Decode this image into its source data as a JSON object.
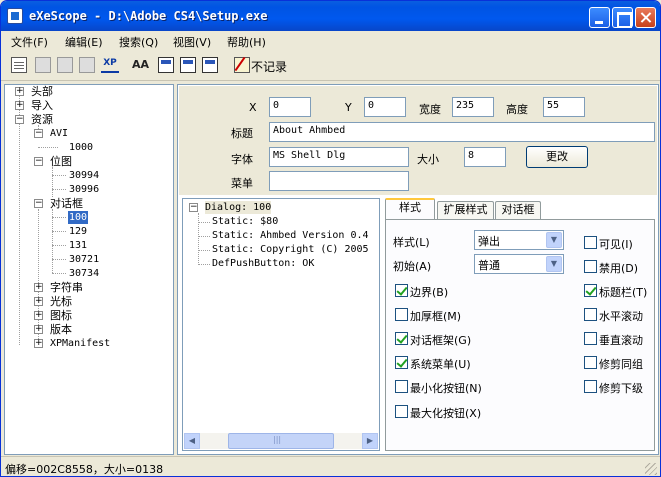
{
  "window": {
    "title": "eXeScope - D:\\Adobe CS4\\Setup.exe"
  },
  "menu": [
    {
      "label": "文件(F)"
    },
    {
      "label": "编辑(E)"
    },
    {
      "label": "搜索(Q)"
    },
    {
      "label": "视图(V)"
    },
    {
      "label": "帮助(H)"
    }
  ],
  "toolbar": {
    "icons": [
      "new-doc-icon",
      "save-icon",
      "save-all-icon",
      "copy-icon",
      "xp-manifest-icon",
      "font-icon",
      "id-icon",
      "dialog-icon",
      "menu-icon",
      "no-log-icon"
    ],
    "xp_text": "XP",
    "aa_text": "AA",
    "nolog_label": "不记录"
  },
  "tree": {
    "header": "头部",
    "import": "导入",
    "resources": "资源",
    "avi": "AVI",
    "avi_1000": "1000",
    "bitmap": "位图",
    "bmp_30994": "30994",
    "bmp_30996": "30996",
    "dialog": "对话框",
    "dlg_100": "100",
    "dlg_129": "129",
    "dlg_131": "131",
    "dlg_30721": "30721",
    "dlg_30734": "30734",
    "string": "字符串",
    "cursor": "光标",
    "icon": "图标",
    "version": "版本",
    "xpmanifest": "XPManifest",
    "expand": "+",
    "collapse": "−"
  },
  "props": {
    "x_label": "X",
    "x_value": "0",
    "y_label": "Y",
    "y_value": "0",
    "width_label": "宽度",
    "width_value": "235",
    "height_label": "高度",
    "height_value": "55",
    "caption_label": "标题",
    "caption_value": "About Ahmbed",
    "font_label": "字体",
    "font_value": "MS Shell Dlg",
    "size_label": "大小",
    "size_value": "8",
    "change_button": "更改",
    "menu_label": "菜单",
    "menu_value": ""
  },
  "dialog_tree": {
    "root": "Dialog: 100",
    "items": [
      "Static: $80",
      "Static: Ahmbed Version 0.4",
      "Static: Copyright (C) 2005",
      "DefPushButton: OK"
    ],
    "collapse": "−",
    "scroll_left": "◀",
    "scroll_right": "▶",
    "scroll_grip": "|||"
  },
  "tabs": [
    {
      "label": "样式"
    },
    {
      "label": "扩展样式"
    },
    {
      "label": "对话框"
    }
  ],
  "style_tab": {
    "style_label": "样式(L)",
    "style_value": "弹出",
    "init_label": "初始(A)",
    "init_value": "普通",
    "dropdown_arrow": "▼",
    "checkboxes_left": [
      {
        "label": "边界(B)",
        "checked": true
      },
      {
        "label": "加厚框(M)",
        "checked": false
      },
      {
        "label": "对话框架(G)",
        "checked": true
      },
      {
        "label": "系统菜单(U)",
        "checked": true
      },
      {
        "label": "最小化按钮(N)",
        "checked": false
      },
      {
        "label": "最大化按钮(X)",
        "checked": false
      }
    ],
    "checkboxes_right": [
      {
        "label": "可见(I)",
        "checked": false
      },
      {
        "label": "禁用(D)",
        "checked": false
      },
      {
        "label": "标题栏(T)",
        "checked": true
      },
      {
        "label": "水平滚动",
        "checked": false
      },
      {
        "label": "垂直滚动",
        "checked": false
      },
      {
        "label": "修剪同组",
        "checked": false
      },
      {
        "label": "修剪下级",
        "checked": false
      }
    ]
  },
  "status": {
    "text": "偏移=002C8558，大小=0138"
  }
}
